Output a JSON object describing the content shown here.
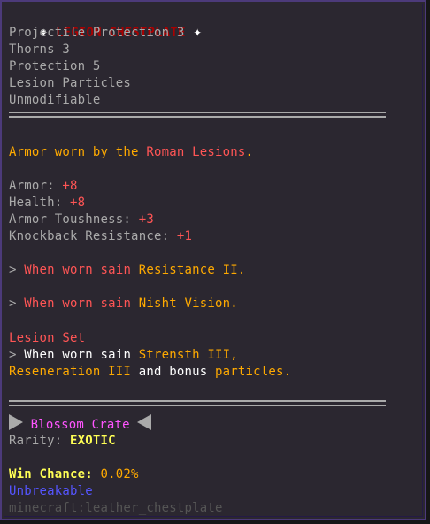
{
  "item": {
    "name_prefix": "✦",
    "name": "LEGION CHESTPLATE",
    "name_suffix": "✦"
  },
  "enchantments": [
    "Projectile Protection 3",
    "Thorns 3",
    "Protection 5",
    "Lesion Particles",
    "Unmodifiable"
  ],
  "lore": {
    "description_a": "Armor worn by the ",
    "description_b": "Roman Lesions",
    "description_c": "."
  },
  "stats": [
    {
      "label": "Armor: ",
      "value": "+8"
    },
    {
      "label": "Health: ",
      "value": "+8"
    },
    {
      "label": "Armor Toushness: ",
      "value": "+3"
    },
    {
      "label": "Knockback Resistance: ",
      "value": "+1"
    }
  ],
  "effects": [
    {
      "arrow": ">",
      "text": " When worn sain ",
      "effect": "Resistance II."
    },
    {
      "arrow": ">",
      "text": " When worn sain ",
      "effect": "Nisht Vision."
    }
  ],
  "set": {
    "title": "Lesion Set",
    "arrow": ">",
    "line1_a": " When worn sain ",
    "line1_b": "Strensth III,",
    "line2_a": "Reseneration III",
    "line2_b": " and bonus ",
    "line2_c": "particles."
  },
  "crate": {
    "name": "Blossom Crate",
    "rarity_label": "Rarity: ",
    "rarity_value": "EXOTIC",
    "win_label": "Win Chance: ",
    "win_value": "0.02%"
  },
  "footer": {
    "unbreakable": "Unbreakable",
    "item_id": "minecraft:leather_chestplate"
  }
}
